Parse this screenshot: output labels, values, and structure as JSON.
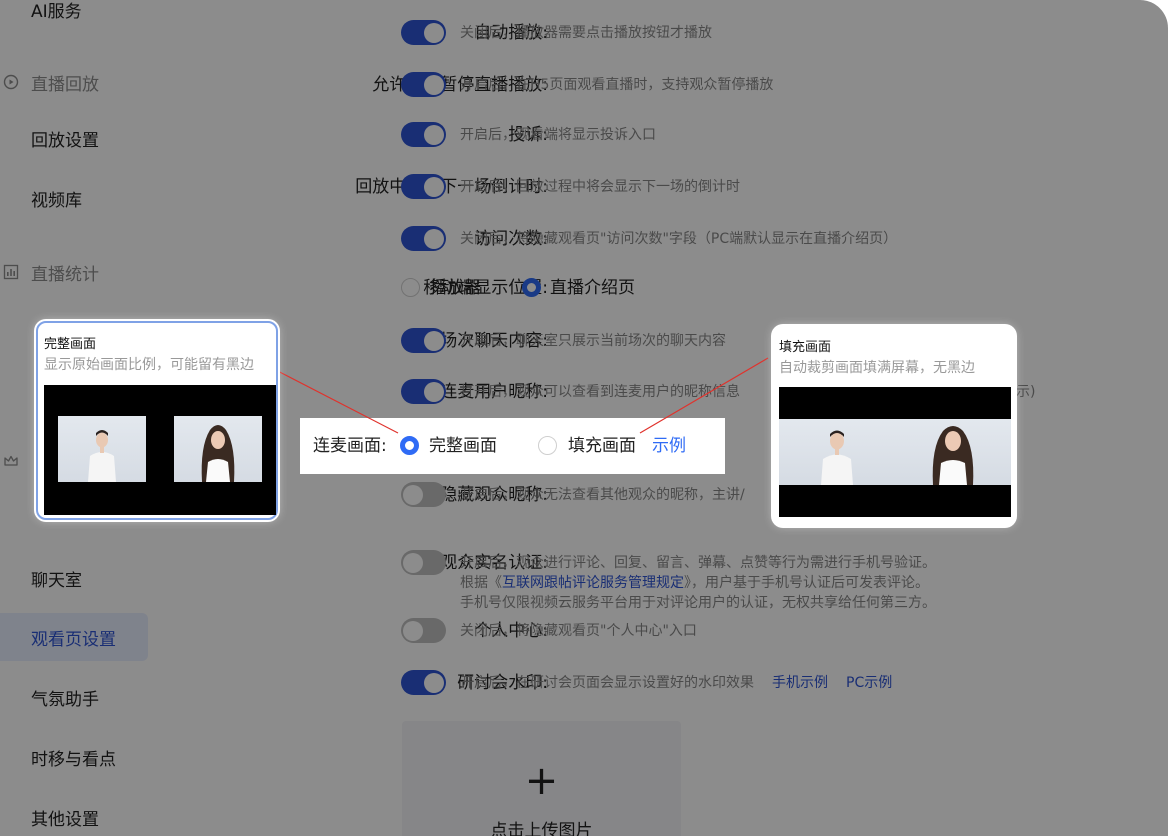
{
  "sidebar": {
    "top_partial": "AI服务",
    "group_replay": "直播回放",
    "item_replay_settings": "回放设置",
    "item_video_library": "视频库",
    "group_stats": "直播统计",
    "item_chatroom": "聊天室",
    "item_viewpage_settings": "观看页设置",
    "item_atmosphere": "气氛助手",
    "item_timeshift": "时移与看点",
    "item_other": "其他设置"
  },
  "settings": {
    "autoplay": {
      "label": "自动播放:",
      "desc": "关闭后，播放器需要点击播放按钮才播放"
    },
    "pause_live": {
      "label": "允许观众暂停直播播放:",
      "desc": "开启后，在H5页面观看直播时，支持观众暂停播放"
    },
    "complaint": {
      "label": "投诉:",
      "desc": "开启后，观看端将显示投诉入口"
    },
    "countdown": {
      "label": "回放中显示下一场倒计时:",
      "desc": "开启后，回放过程中将会显示下一场的倒计时"
    },
    "visits": {
      "label": "访问次数:",
      "desc": "关闭后，将隐藏观看页\"访问次数\"字段（PC端默认显示在直播介绍页）"
    },
    "mobile_position": {
      "label": "移动端显示位置:",
      "option_player": "播放器",
      "option_intro": "直播介绍页"
    },
    "session_chat": {
      "label": "场次聊天内容:",
      "desc": "开启后，聊天室只展示当前场次的聊天内容"
    },
    "mic_nickname": {
      "label": "连麦用户昵称:",
      "desc": "打开后，观众可以查看到连麦用户的昵称信息",
      "tail": "示)"
    },
    "mic_view": {
      "label": "连麦画面:",
      "option_full": "完整画面",
      "option_fill": "填充画面",
      "example": "示例"
    },
    "hide_nickname": {
      "label": "隐藏观众昵称:",
      "desc": "开启后，观众无法查看其他观众的昵称，主讲/"
    },
    "realname": {
      "label": "观众实名认证:",
      "line1": "开启后，观众进行评论、回复、留言、弹幕、点赞等行为需进行手机号验证。",
      "line2_pre": "根据《",
      "line2_link": "互联网跟帖评论服务管理规定",
      "line2_post": "》，用户基于手机号认证后可发表评论。",
      "line3": "手机号仅限视频云服务平台用于对评论用户的认证，无权共享给任何第三方。"
    },
    "personal_center": {
      "label": "个人中心:",
      "desc": "关闭后，将隐藏观看页\"个人中心\"入口"
    },
    "watermark": {
      "label": "研讨会水印:",
      "desc": "开启后，在研讨会页面会显示设置好的水印效果",
      "link_mobile": "手机示例",
      "link_pc": "PC示例"
    }
  },
  "upload": {
    "plus": "+",
    "text": "点击上传图片"
  },
  "popup_full": {
    "title": "完整画面",
    "subtitle": "显示原始画面比例，可能留有黑边"
  },
  "popup_fill": {
    "title": "填充画面",
    "subtitle": "自动裁剪画面填满屏幕，无黑边"
  },
  "colors": {
    "accent": "#2f55d4",
    "radio": "#2f6bf5",
    "connector": "#e0322c"
  }
}
